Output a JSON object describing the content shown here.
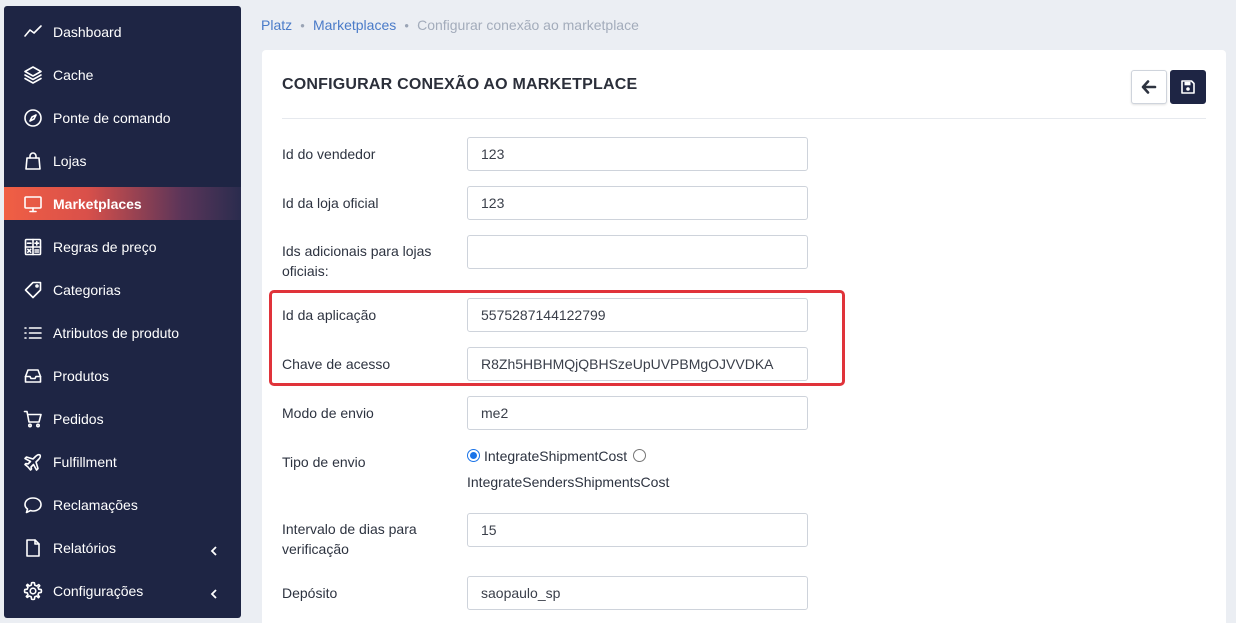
{
  "sidebar": {
    "items": [
      {
        "label": "Dashboard",
        "icon": "chart-line-icon"
      },
      {
        "label": "Cache",
        "icon": "layers-icon"
      },
      {
        "label": "Ponte de comando",
        "icon": "compass-icon"
      },
      {
        "label": "Lojas",
        "icon": "shopping-bag-icon"
      },
      {
        "label": "Marketplaces",
        "icon": "monitor-icon",
        "active": true
      },
      {
        "label": "Regras de preço",
        "icon": "calculator-icon"
      },
      {
        "label": "Categorias",
        "icon": "tag-icon"
      },
      {
        "label": "Atributos de produto",
        "icon": "list-icon"
      },
      {
        "label": "Produtos",
        "icon": "inbox-icon"
      },
      {
        "label": "Pedidos",
        "icon": "cart-icon"
      },
      {
        "label": "Fulfillment",
        "icon": "plane-icon"
      },
      {
        "label": "Reclamações",
        "icon": "chat-bubble-icon"
      },
      {
        "label": "Relatórios",
        "icon": "file-icon",
        "expandable": true
      },
      {
        "label": "Configurações",
        "icon": "gear-icon",
        "expandable": true
      }
    ]
  },
  "breadcrumb": {
    "items": [
      "Platz",
      "Marketplaces"
    ],
    "current": "Configurar conexão ao marketplace"
  },
  "card": {
    "title": "CONFIGURAR CONEXÃO AO MARKETPLACE"
  },
  "form": {
    "seller_id": {
      "label": "Id do vendedor",
      "value": "123"
    },
    "official_store_id": {
      "label": "Id da loja oficial",
      "value": "123"
    },
    "additional_store_ids": {
      "label": "Ids adicionais para lojas oficiais:",
      "value": ""
    },
    "app_id": {
      "label": "Id da aplicação",
      "value": "5575287144122799"
    },
    "access_key": {
      "label": "Chave de acesso",
      "value": "R8Zh5HBHMQjQBHSzeUpUVPBMgOJVVDKA"
    },
    "shipping_mode": {
      "label": "Modo de envio",
      "value": "me2"
    },
    "shipping_type": {
      "label": "Tipo de envio",
      "option_1": "IntegrateShipmentCost",
      "option_2": "IntegrateSendersShipmentsCost",
      "selected": "IntegrateShipmentCost"
    },
    "check_interval": {
      "label": "Intervalo de dias para verificação",
      "value": "15"
    },
    "warehouse": {
      "label": "Depósito",
      "value": "saopaulo_sp"
    }
  },
  "colors": {
    "sidebar_bg": "#1e2544",
    "active_gradient_start": "#f05f44",
    "link": "#4a7bc8",
    "highlight_border": "#e0333a"
  }
}
